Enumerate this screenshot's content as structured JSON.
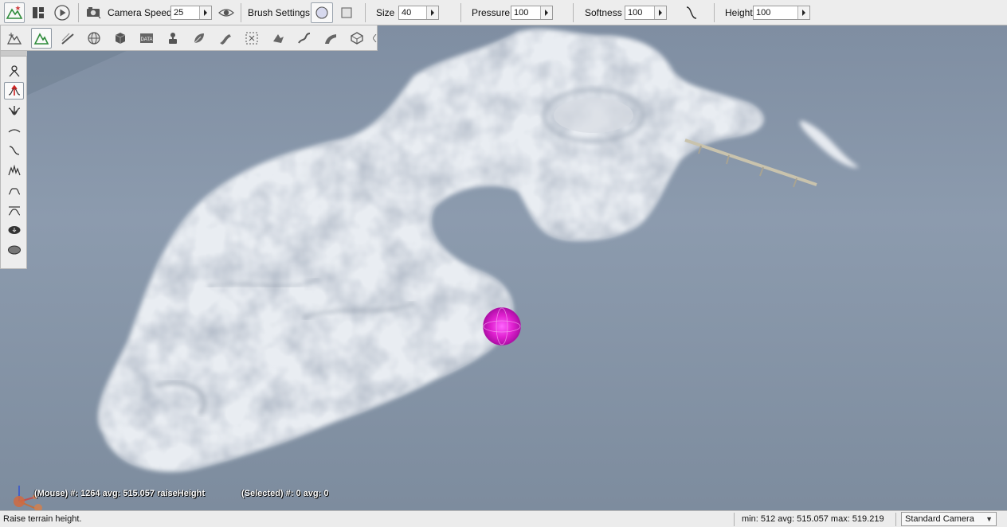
{
  "toolbar": {
    "camera_speed_label": "Camera Speed",
    "camera_speed_value": "25",
    "brush_settings_label": "Brush Settings",
    "size_label": "Size",
    "size_value": "40",
    "pressure_label": "Pressure",
    "pressure_value": "100",
    "softness_label": "Softness",
    "softness_value": "100",
    "height_label": "Height",
    "height_value": "100"
  },
  "tool_palette": {
    "icons": [
      "terrain-select-icon",
      "terrain-paint-icon",
      "road-draw-icon",
      "globe-icon",
      "mesh-cube-icon",
      "data-block-icon",
      "spawn-point-icon",
      "forest-leaf-icon",
      "river-icon",
      "decal-select-icon",
      "shape-icon",
      "path-icon",
      "mesh-road-icon",
      "navmesh-icon"
    ],
    "data_icon_text": "DATA",
    "active_index": 1
  },
  "brush_palette": {
    "icons": [
      "grab-terrain-icon",
      "raise-height-icon",
      "lower-height-icon",
      "smooth-height-icon",
      "slope-icon",
      "paint-noise-icon",
      "flatten-icon",
      "set-height-icon",
      "set-empty-icon",
      "clear-empty-icon"
    ],
    "active_index": 1
  },
  "overlay": {
    "mouse_stats": "(Mouse) #: 1264  avg: 515.057 raiseHeight",
    "selected_stats": "(Selected) #: 0  avg: 0"
  },
  "statusbar": {
    "message": "Raise terrain height.",
    "stats": "min: 512  avg: 515.057  max: 519.219",
    "camera": "Standard Camera"
  },
  "colors": {
    "brush": "#e020d0",
    "water": "#8a9aab",
    "snow": "#e8ecf1",
    "accent_green": "#2e8b3a"
  }
}
